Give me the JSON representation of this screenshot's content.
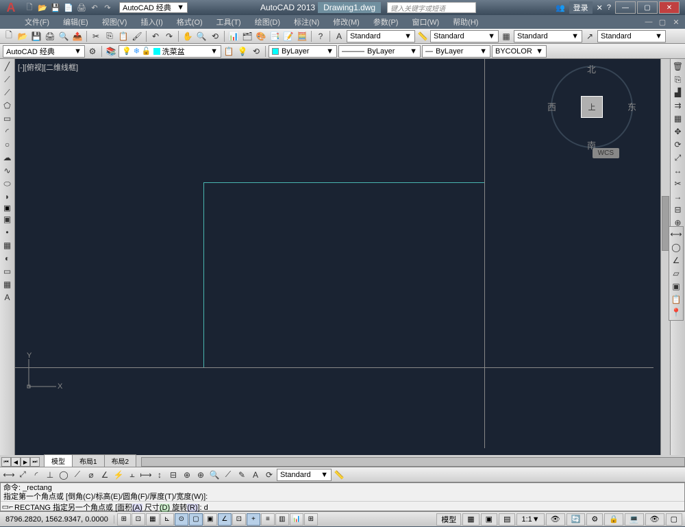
{
  "title": {
    "app": "AutoCAD 2013",
    "file": "Drawing1.dwg",
    "search_placeholder": "键入关键字或短语",
    "login": "登录"
  },
  "workspace": "AutoCAD 经典",
  "menu": {
    "file": "文件(F)",
    "edit": "编辑(E)",
    "view": "视图(V)",
    "insert": "插入(I)",
    "format": "格式(O)",
    "tools": "工具(T)",
    "draw": "绘图(D)",
    "dimension": "标注(N)",
    "modify": "修改(M)",
    "parametric": "参数(P)",
    "window": "窗口(W)",
    "help": "帮助(H)"
  },
  "styles": {
    "text": "Standard",
    "dim": "Standard",
    "table": "Standard",
    "mleader": "Standard"
  },
  "workspace2": "AutoCAD 经典",
  "layerbox": "洗菜盆",
  "layer": "ByLayer",
  "linetype": "ByLayer",
  "lineweight": "ByLayer",
  "plotstyle": "BYCOLOR",
  "viewport_label": "[-][俯视][二维线框]",
  "compass": {
    "n": "北",
    "s": "南",
    "e": "东",
    "w": "西",
    "top": "上"
  },
  "wcs": "WCS",
  "ucs": {
    "x": "X",
    "y": "Y"
  },
  "tabs": {
    "model": "模型",
    "layout1": "布局1",
    "layout2": "布局2"
  },
  "dimstyle": "Standard",
  "cmd": {
    "line1": "命令: _rectang",
    "line2": "指定第一个角点或 [倒角(C)/标高(E)/圆角(F)/厚度(T)/宽度(W)]:",
    "prefix": "RECTANG 指定另一个角点或 [面积",
    "a": "(A)",
    "mid1": " 尺寸",
    "d": "(D)",
    "mid2": " 旋转",
    "r": "(R)",
    "suffix": "]: ",
    "input": "d"
  },
  "status": {
    "coords": "8796.2820, 1562.9347, 0.0000",
    "space": "模型",
    "scale": "1:1"
  },
  "icons": {
    "new": "🗋",
    "open": "📂",
    "save": "💾",
    "print": "🖨",
    "undo": "↶",
    "redo": "↷",
    "cut": "✂",
    "copy": "⎘",
    "paste": "📋",
    "match": "🖌",
    "line": "╱",
    "pline": "⟋",
    "polygon": "⬠",
    "rect": "▭",
    "arc": "◜",
    "circle": "○",
    "spline": "∿",
    "ellipse": "⬭",
    "ellipsearc": "◗",
    "block": "▣",
    "point": "•",
    "hatch": "▦",
    "region": "▭",
    "table": "▦",
    "text": "A",
    "erase": "🗑",
    "copym": "⎘",
    "mirror": "▟",
    "offset": "⇉",
    "array": "▦",
    "move": "✥",
    "rotate": "⟳",
    "scale": "⤢",
    "stretch": "↔",
    "trim": "✂",
    "extend": "→",
    "break": "⊟",
    "join": "⊕",
    "chamfer": "◣",
    "fillet": "◟",
    "explode": "✸",
    "dist": "⟷",
    "area": "▱",
    "pan": "✋",
    "zoom": "🔍",
    "gear": "⚙"
  }
}
